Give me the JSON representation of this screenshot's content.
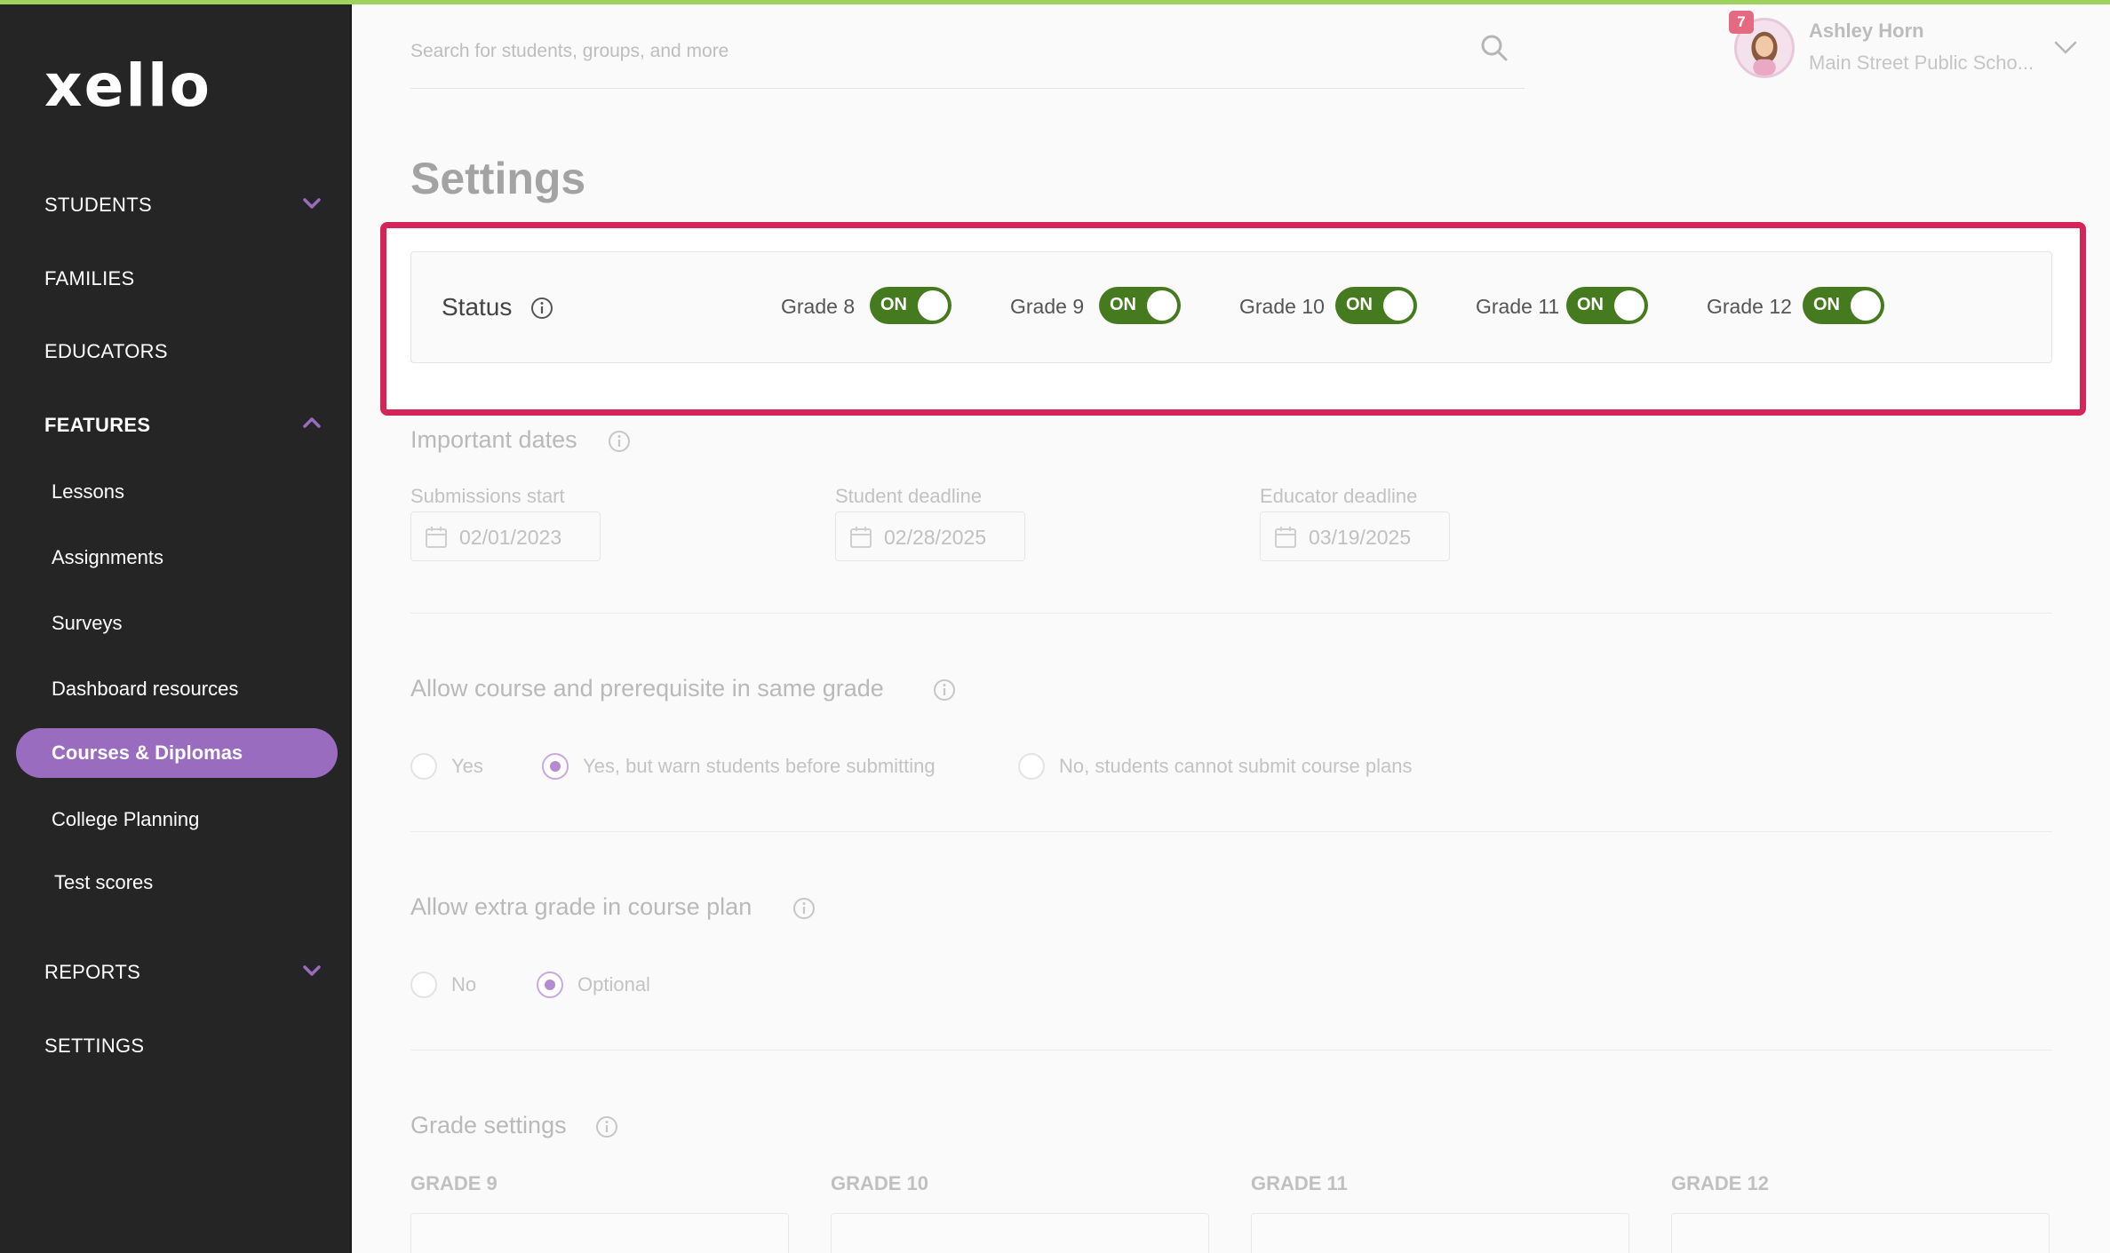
{
  "brand": {
    "logo": "xello",
    "accent": "#9a6cc0",
    "toggle_color": "#467a1f",
    "highlight_color": "#d4245a"
  },
  "sidebar": {
    "items": [
      {
        "label": "STUDENTS",
        "expand": "chevron-down-icon"
      },
      {
        "label": "FAMILIES"
      },
      {
        "label": "EDUCATORS"
      },
      {
        "label": "FEATURES",
        "expand": "chevron-up-icon"
      },
      {
        "label": "REPORTS",
        "expand": "chevron-down-icon"
      },
      {
        "label": "SETTINGS"
      }
    ],
    "features_sub": [
      "Lessons",
      "Assignments",
      "Surveys",
      "Dashboard resources",
      "Courses & Diplomas",
      "College Planning",
      "Test scores"
    ],
    "active": "Courses & Diplomas"
  },
  "header": {
    "search_placeholder": "Search for students, groups, and more",
    "notification_count": "7",
    "user_name": "Ashley Horn",
    "user_school": "Main Street Public Scho..."
  },
  "page": {
    "title": "Settings"
  },
  "status": {
    "label": "Status",
    "grades": [
      {
        "label": "Grade 8",
        "state": "ON"
      },
      {
        "label": "Grade 9",
        "state": "ON"
      },
      {
        "label": "Grade 10",
        "state": "ON"
      },
      {
        "label": "Grade 11",
        "state": "ON"
      },
      {
        "label": "Grade 12",
        "state": "ON"
      }
    ]
  },
  "dates": {
    "title": "Important dates",
    "fields": [
      {
        "label": "Submissions start",
        "value": "02/01/2023"
      },
      {
        "label": "Student deadline",
        "value": "02/28/2025"
      },
      {
        "label": "Educator deadline",
        "value": "03/19/2025"
      }
    ]
  },
  "same_grade": {
    "title": "Allow course and prerequisite in same grade",
    "options": [
      "Yes",
      "Yes, but warn students before submitting",
      "No, students cannot submit course plans"
    ],
    "selected": "Yes, but warn students before submitting"
  },
  "extra_grade": {
    "title": "Allow extra grade in course plan",
    "options": [
      "No",
      "Optional"
    ],
    "selected": "Optional"
  },
  "grade_settings": {
    "title": "Grade settings",
    "columns": [
      "GRADE 9",
      "GRADE 10",
      "GRADE 11",
      "GRADE 12"
    ]
  }
}
